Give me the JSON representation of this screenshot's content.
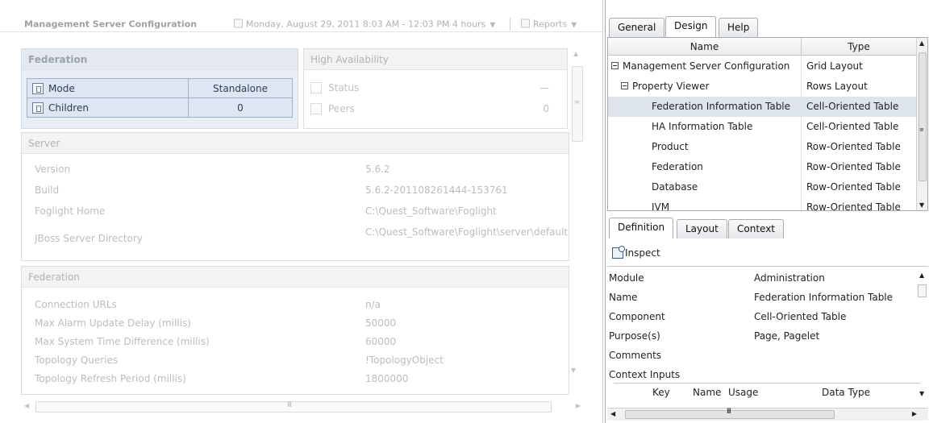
{
  "left_pane": {
    "title": "Management Server Configuration",
    "time_range": "Monday, August 29, 2011 8:03 AM - 12:03 PM 4 hours",
    "reports_label": "Reports",
    "federation": {
      "header": "Federation",
      "rows": [
        {
          "label": "Mode",
          "value": "Standalone"
        },
        {
          "label": "Children",
          "value": "0"
        }
      ]
    },
    "high_availability": {
      "header": "High Availability",
      "rows": [
        {
          "label": "Status",
          "value": "—"
        },
        {
          "label": "Peers",
          "value": "0"
        }
      ]
    },
    "server": {
      "header": "Server",
      "rows": [
        {
          "key": "Version",
          "value": "5.6.2"
        },
        {
          "key": "Build",
          "value": "5.6.2-201108261444-153761"
        },
        {
          "key": "Foglight Home",
          "value": "C:\\Quest_Software\\Foglight"
        },
        {
          "key": "JBoss Server Directory",
          "value": "C:\\Quest_Software\\Foglight\\server\\default"
        }
      ]
    },
    "federation_details": {
      "header": "Federation",
      "rows": [
        {
          "key": "Connection URLs",
          "value": "n/a"
        },
        {
          "key": "Max Alarm Update Delay (millis)",
          "value": "50000"
        },
        {
          "key": "Max System Time Difference (millis)",
          "value": "60000"
        },
        {
          "key": "Topology Queries",
          "value": "!TopologyObject"
        },
        {
          "key": "Topology Refresh Period (millis)",
          "value": "1800000"
        }
      ]
    }
  },
  "right_pane": {
    "top_tabs": [
      "General",
      "Design",
      "Help"
    ],
    "active_top_tab": "Design",
    "tree": {
      "col_name": "Name",
      "col_type": "Type",
      "rows": [
        {
          "name": "Management Server Configuration",
          "type": "Grid Layout"
        },
        {
          "name": "Property Viewer",
          "type": "Rows Layout"
        },
        {
          "name": "Federation Information Table",
          "type": "Cell-Oriented Table"
        },
        {
          "name": "HA Information Table",
          "type": "Cell-Oriented Table"
        },
        {
          "name": "Product",
          "type": "Row-Oriented Table"
        },
        {
          "name": "Federation",
          "type": "Row-Oriented Table"
        },
        {
          "name": "Database",
          "type": "Row-Oriented Table"
        },
        {
          "name": "JVM",
          "type": "Row-Oriented Table"
        }
      ]
    },
    "bottom_tabs": [
      "Definition",
      "Layout",
      "Context"
    ],
    "active_bottom_tab": "Definition",
    "inspect_label": "Inspect",
    "properties": [
      {
        "key": "Module",
        "value": "Administration"
      },
      {
        "key": "Name",
        "value": "Federation Information Table"
      },
      {
        "key": "Component",
        "value": "Cell-Oriented Table"
      },
      {
        "key": "Purpose(s)",
        "value": "Page, Pagelet"
      },
      {
        "key": "Comments",
        "value": ""
      },
      {
        "key": "Context Inputs",
        "value": ""
      }
    ],
    "context_columns": [
      "Key",
      "Name",
      "Usage",
      "Data Type"
    ]
  },
  "colors": {
    "selection": "#dde4ee",
    "fed_panel_bg": "#e9eef5",
    "fed_cell_border": "#9fb2cc",
    "muted_text": "#bdbdbd"
  }
}
